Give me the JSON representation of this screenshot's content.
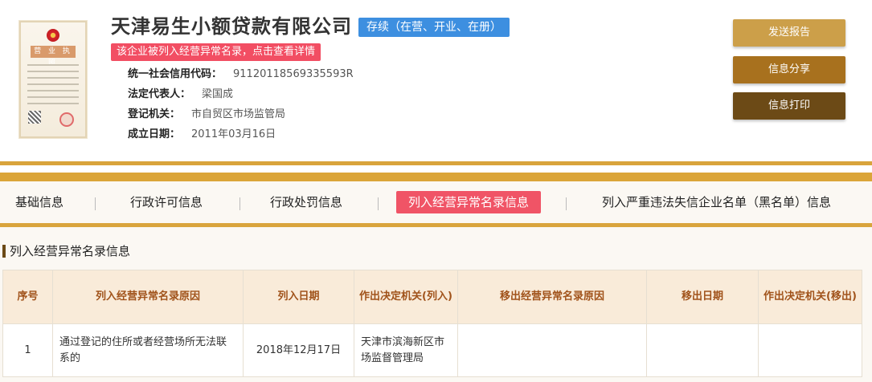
{
  "company": {
    "name": "天津易生小额贷款有限公司",
    "status": "存续（在营、开业、在册）",
    "abnormal_alert": "该企业被列入经营异常名录，点击查看详情",
    "license_title": "营 业 执 照",
    "fields": [
      {
        "label": "统一社会信用代码：",
        "value": "91120118569335593R"
      },
      {
        "label": "法定代表人：",
        "value": "梁国成"
      },
      {
        "label": "登记机关：",
        "value": "市自贸区市场监管局"
      },
      {
        "label": "成立日期：",
        "value": "2011年03月16日"
      }
    ]
  },
  "actions": {
    "report": "发送报告",
    "share": "信息分享",
    "print": "信息打印"
  },
  "tabs": [
    {
      "label": "基础信息",
      "active": false
    },
    {
      "label": "行政许可信息",
      "active": false
    },
    {
      "label": "行政处罚信息",
      "active": false
    },
    {
      "label": "列入经营异常名录信息",
      "active": true
    },
    {
      "label": "列入严重违法失信企业名单（黑名单）信息",
      "active": false
    }
  ],
  "section": {
    "title": "列入经营异常名录信息",
    "columns": [
      "序号",
      "列入经营异常名录原因",
      "列入日期",
      "作出决定机关(列入)",
      "移出经营异常名录原因",
      "移出日期",
      "作出决定机关(移出)"
    ],
    "rows": [
      [
        "1",
        "通过登记的住所或者经营场所无法联系的",
        "2018年12月17日",
        "天津市滨海新区市场监督管理局",
        "",
        "",
        ""
      ]
    ]
  },
  "colors": {
    "gold": "#d9a43c",
    "badge_blue": "#3d8fe0",
    "alert_red": "#f24e63",
    "tab_active": "#f05466",
    "th_bg": "#f9ebd9",
    "th_text": "#a0521a"
  }
}
